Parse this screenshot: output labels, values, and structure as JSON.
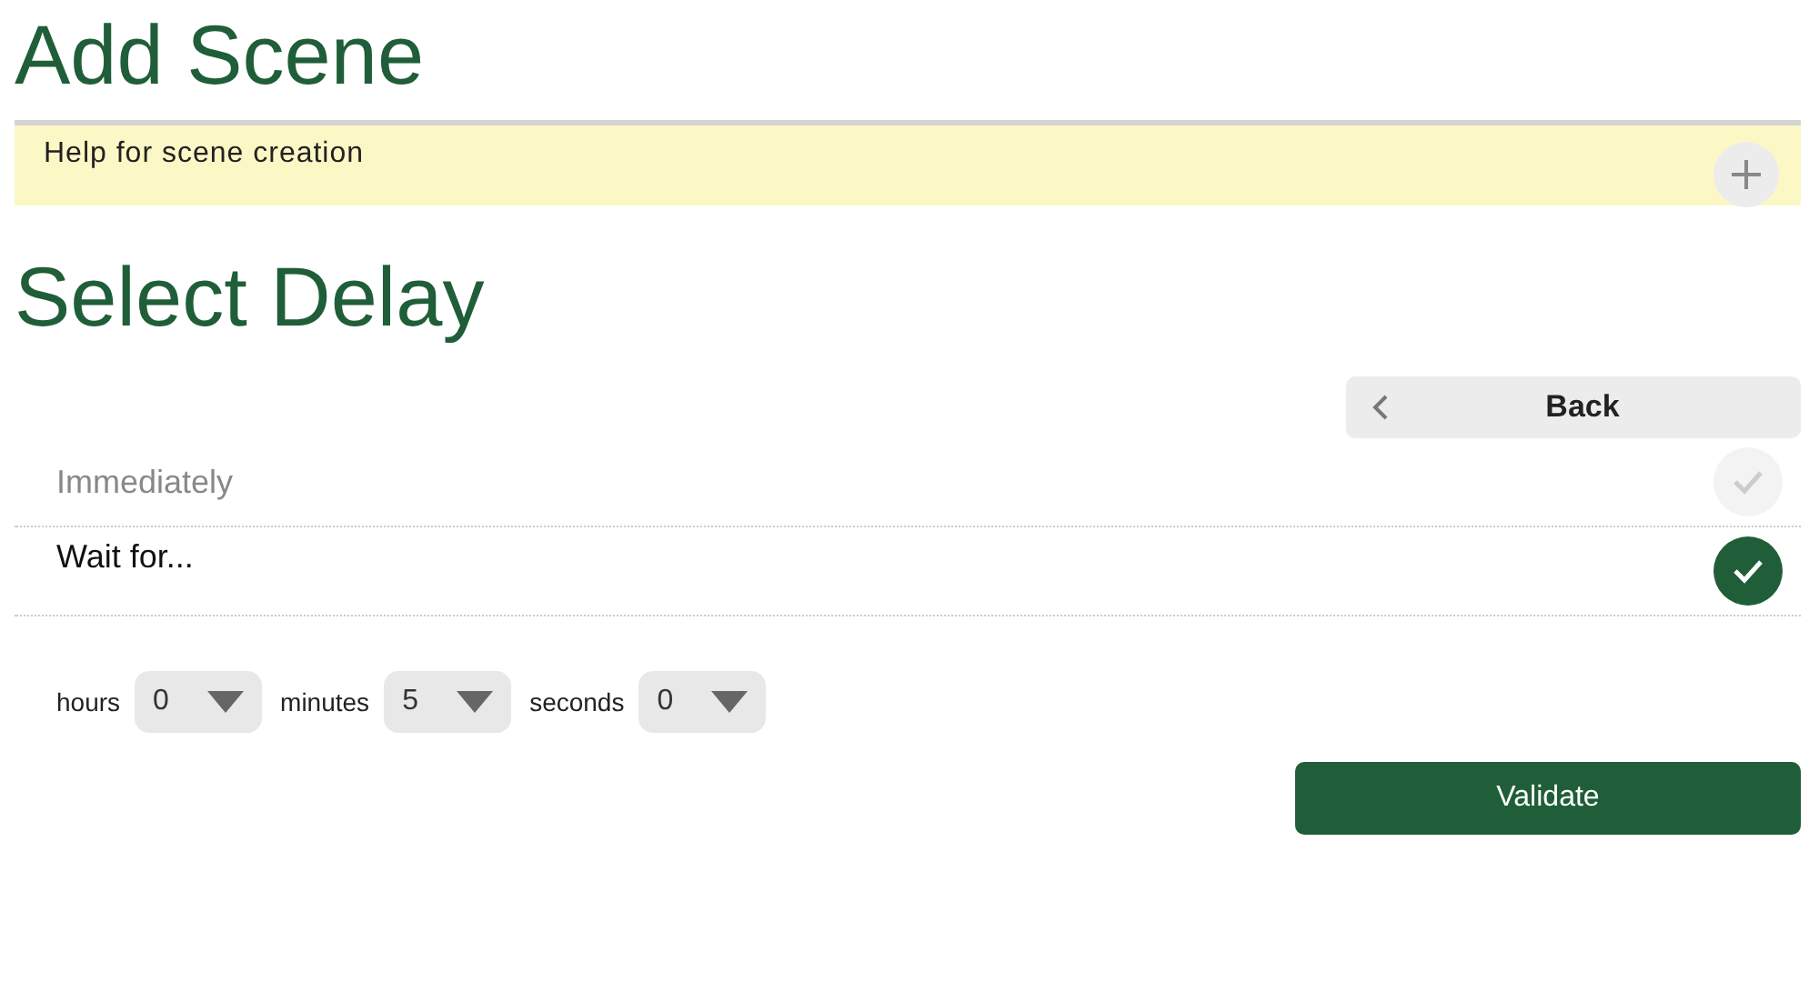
{
  "title": "Add Scene",
  "help": {
    "label": "Help for scene creation"
  },
  "heading": "Select Delay",
  "back_button": "Back",
  "options": [
    {
      "label": "Immediately",
      "selected": false
    },
    {
      "label": "Wait for...",
      "selected": true
    }
  ],
  "delay": [
    {
      "label": "hours",
      "value": "0"
    },
    {
      "label": "minutes",
      "value": "5"
    },
    {
      "label": "seconds",
      "value": "0"
    }
  ],
  "validate_button": "Validate"
}
